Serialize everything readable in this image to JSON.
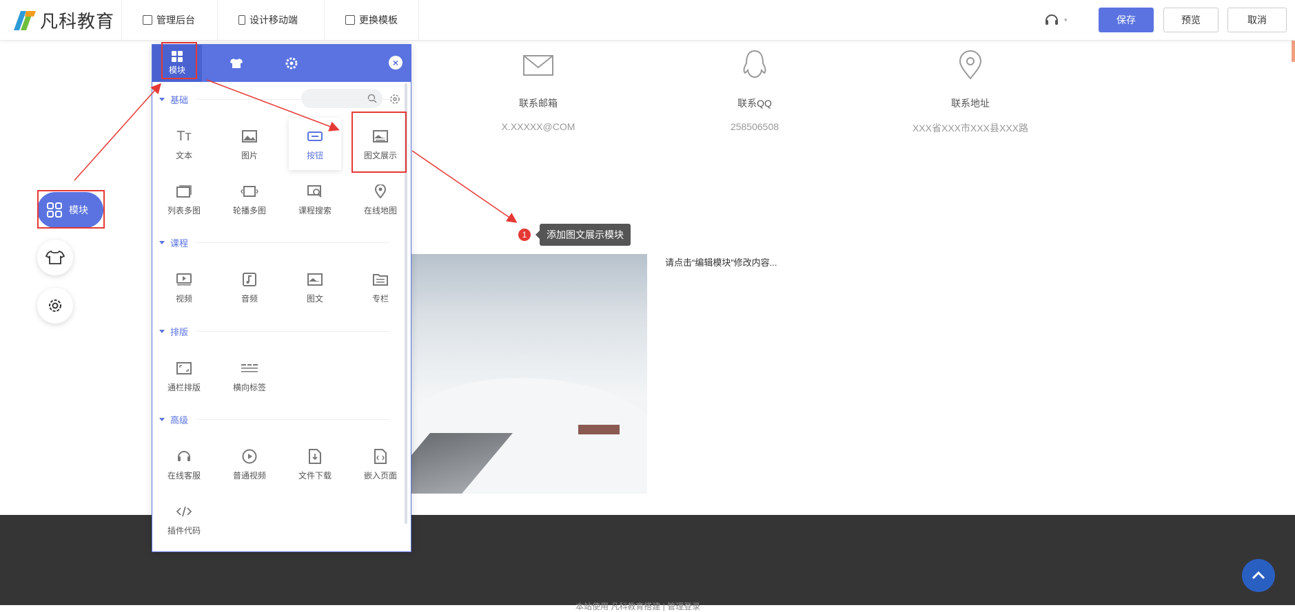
{
  "header": {
    "logo_text": "凡科教育",
    "nav": [
      {
        "label": "管理后台",
        "icon": "chart-icon"
      },
      {
        "label": "设计移动端",
        "icon": "phone-icon"
      },
      {
        "label": "更换模板",
        "icon": "template-icon"
      }
    ],
    "save_label": "保存",
    "preview_label": "预览",
    "cancel_label": "取消"
  },
  "contacts": [
    {
      "label": "联系邮箱",
      "value": "X.XXXXX@COM",
      "icon": "mail-icon"
    },
    {
      "label": "联系QQ",
      "value": "258506508",
      "icon": "qq-icon"
    },
    {
      "label": "联系地址",
      "value": "XXX省XXX市XXX县XXX路",
      "icon": "location-icon"
    }
  ],
  "content": {
    "edit_hint": "请点击“编辑模块”修改内容..."
  },
  "tooltip": {
    "step": "1",
    "text": "添加图文展示模块"
  },
  "left_float": {
    "module_label": "模块"
  },
  "panel": {
    "tabs": [
      {
        "label": "模块",
        "icon": "grid-icon"
      },
      {
        "label": "",
        "icon": "shirt-icon"
      },
      {
        "label": "",
        "icon": "gear-icon"
      }
    ],
    "search_placeholder": "",
    "sections": [
      {
        "title": "基础",
        "items": [
          "文本",
          "图片",
          "按钮",
          "图文展示",
          "列表多图",
          "轮播多图",
          "课程搜索",
          "在线地图"
        ]
      },
      {
        "title": "课程",
        "items": [
          "视频",
          "音频",
          "图文",
          "专栏"
        ]
      },
      {
        "title": "排版",
        "items": [
          "通栏排版",
          "横向标签"
        ]
      },
      {
        "title": "高级",
        "items": [
          "在线客服",
          "普通视频",
          "文件下载",
          "嵌入页面",
          "插件代码"
        ]
      }
    ]
  },
  "footer": {
    "text": "本站使用 凡科教育搭建 | 管理登录"
  },
  "colors": {
    "accent": "#5a73e0",
    "highlight": "#e53935",
    "footer_bg": "#353535"
  }
}
